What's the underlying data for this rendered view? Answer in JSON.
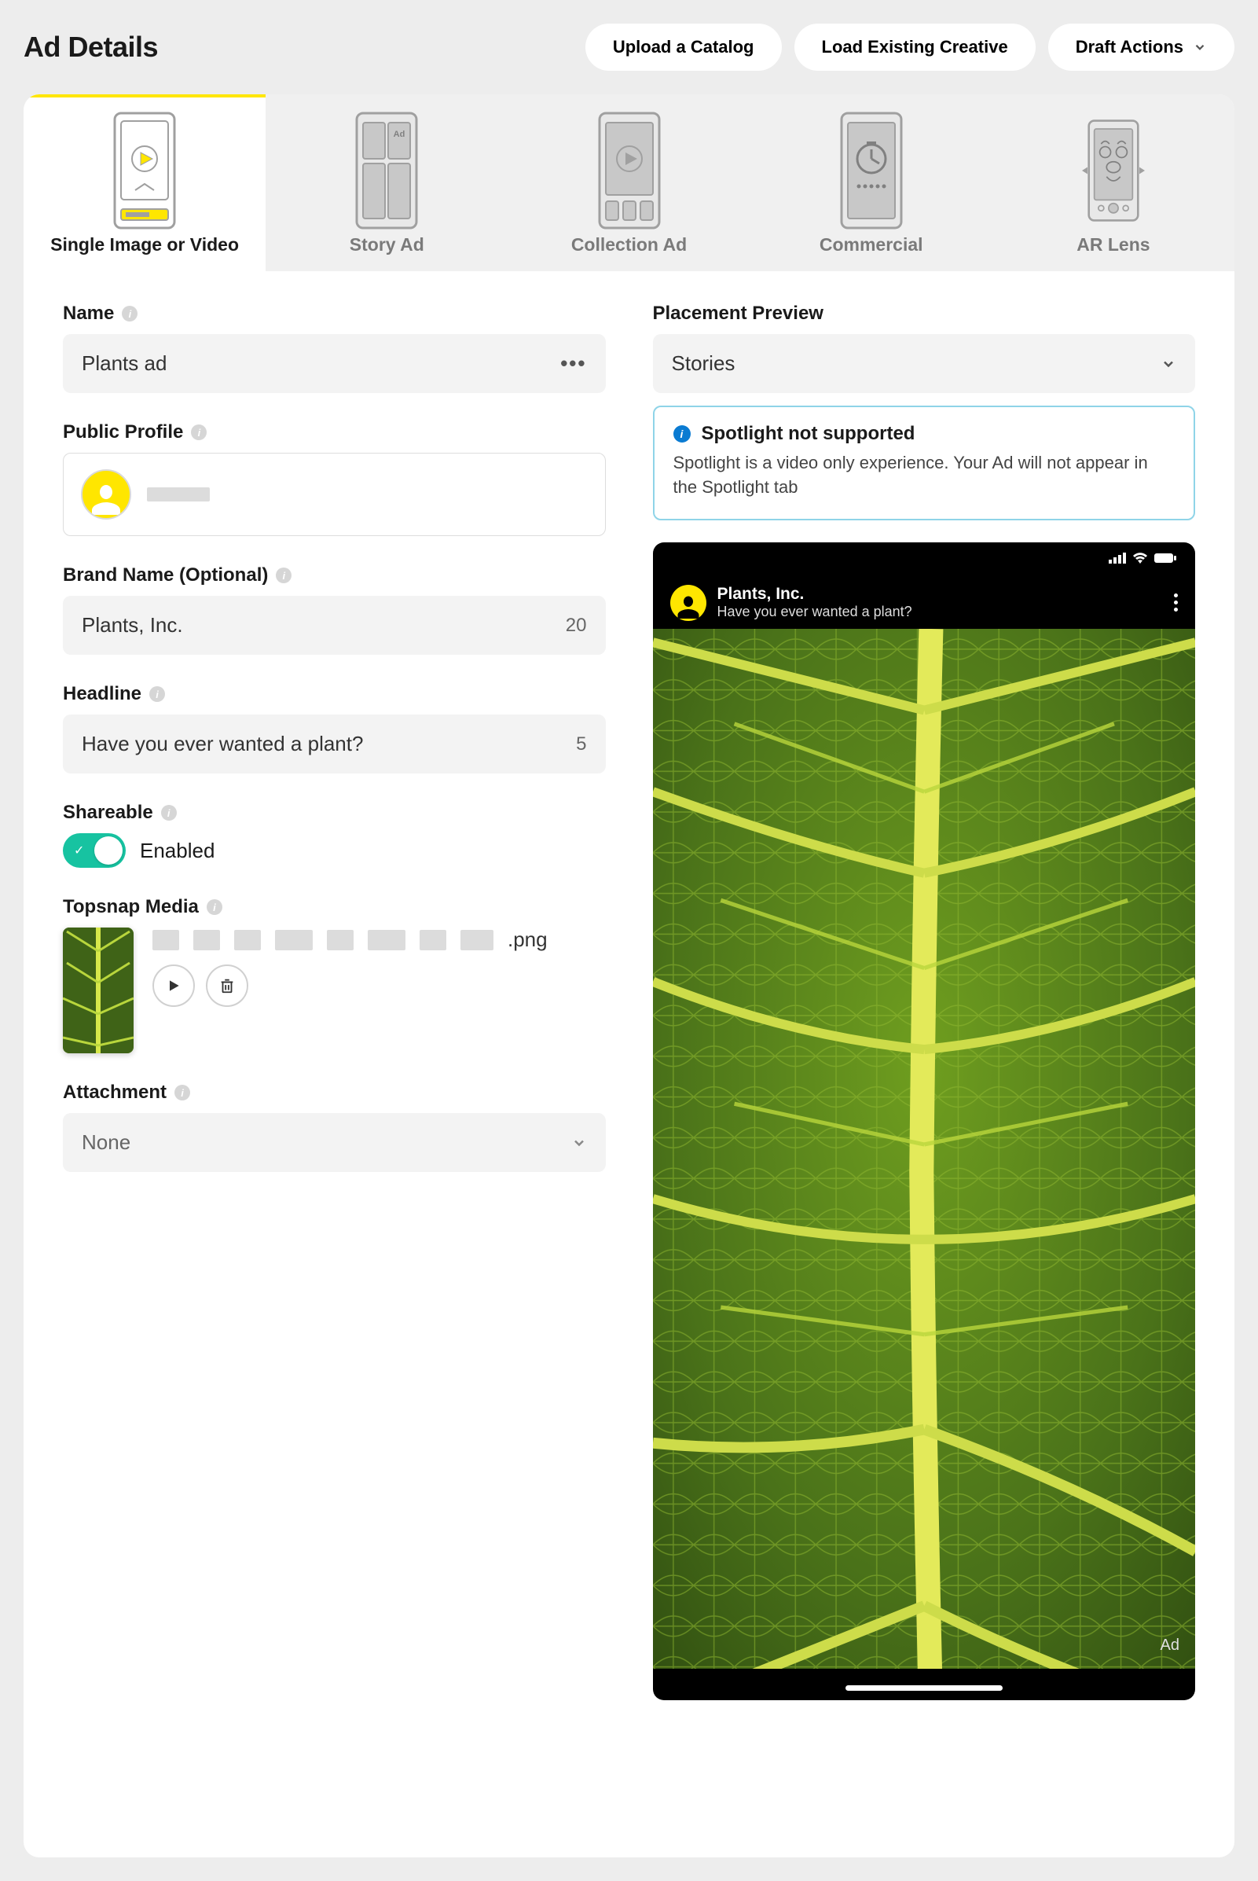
{
  "page": {
    "title": "Ad Details"
  },
  "header_actions": {
    "upload": "Upload a Catalog",
    "load": "Load Existing Creative",
    "draft": "Draft Actions"
  },
  "tabs": [
    {
      "label": "Single Image or Video",
      "active": true
    },
    {
      "label": "Story Ad",
      "active": false
    },
    {
      "label": "Collection Ad",
      "active": false
    },
    {
      "label": "Commercial",
      "active": false
    },
    {
      "label": "AR Lens",
      "active": false
    }
  ],
  "form": {
    "name_label": "Name",
    "name_value": "Plants ad",
    "profile_label": "Public Profile",
    "brand_label": "Brand Name (Optional)",
    "brand_value": "Plants, Inc.",
    "brand_count": "20",
    "headline_label": "Headline",
    "headline_value": "Have you ever wanted a plant?",
    "headline_count": "5",
    "shareable_label": "Shareable",
    "shareable_state": "Enabled",
    "topsnap_label": "Topsnap Media",
    "topsnap_ext": ".png",
    "attachment_label": "Attachment",
    "attachment_value": "None"
  },
  "preview": {
    "section_label": "Placement Preview",
    "placement_value": "Stories",
    "notice_title": "Spotlight not supported",
    "notice_body": "Spotlight is a video only experience. Your Ad will not appear in the Spotlight tab",
    "ad_brand": "Plants, Inc.",
    "ad_headline": "Have you ever wanted a plant?",
    "ad_badge": "Ad"
  }
}
